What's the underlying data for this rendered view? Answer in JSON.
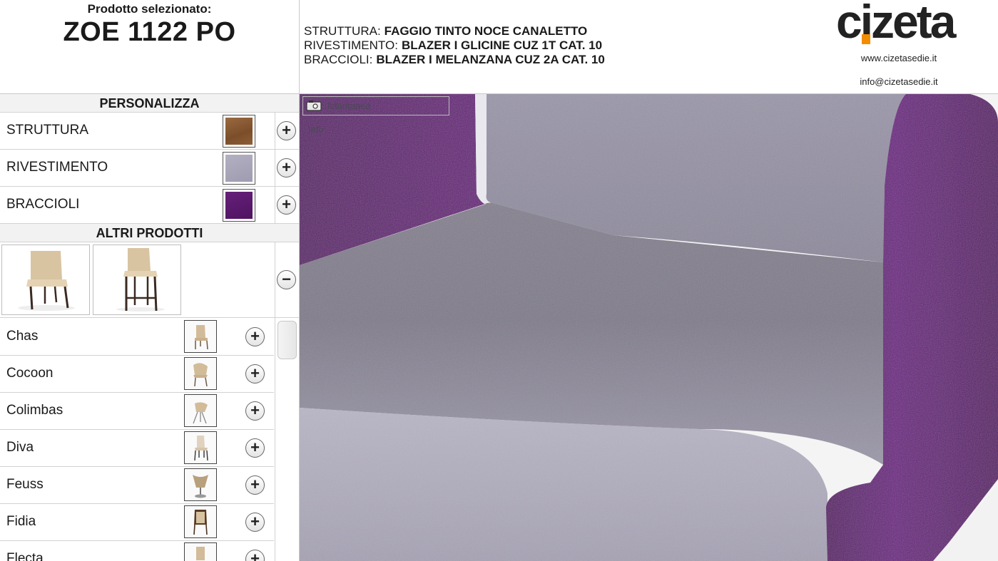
{
  "header": {
    "caption": "Prodotto selezionato:",
    "product_name": "ZOE 1122 PO",
    "specs": [
      {
        "key": "STRUTTURA:",
        "value": "FAGGIO TINTO NOCE CANALETTO"
      },
      {
        "key": "RIVESTIMENTO:",
        "value": "BLAZER I GLICINE CUZ 1T CAT. 10"
      },
      {
        "key": "BRACCIOLI:",
        "value": "BLAZER I MELANZANA CUZ 2A CAT. 10"
      }
    ],
    "logo": "cizeta",
    "website": "www.cizetasedie.it",
    "email": "info@cizetasedie.it"
  },
  "panel": {
    "customize_title": "PERSONALIZZA",
    "options": [
      {
        "label": "STRUTTURA",
        "swatch": "#8a5a32"
      },
      {
        "label": "RIVESTIMENTO",
        "swatch": "#a9a6b8"
      },
      {
        "label": "BRACCIOLI",
        "swatch": "#5c1a6b"
      }
    ],
    "other_title": "ALTRI PRODOTTI",
    "products": [
      {
        "label": "Chas"
      },
      {
        "label": "Cocoon"
      },
      {
        "label": "Colimbas"
      },
      {
        "label": "Diva"
      },
      {
        "label": "Feuss"
      },
      {
        "label": "Fidia"
      },
      {
        "label": "Flecta"
      }
    ]
  },
  "viewer": {
    "snapshot_label": "Istantanea",
    "info_label": "Info"
  },
  "colors": {
    "fabric": "#8f8aa0",
    "arm": "#6b1c7e"
  }
}
